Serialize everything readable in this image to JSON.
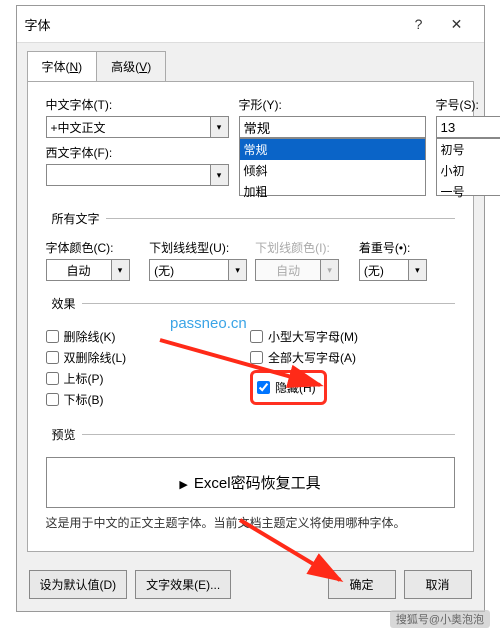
{
  "dialog_title": "字体",
  "tabs": {
    "font": "字体(N)",
    "adv": "高级(V)"
  },
  "labels": {
    "cn_font": "中文字体(T):",
    "west_font": "西文字体(F):",
    "style": "字形(Y):",
    "size": "字号(S):",
    "all_text": "所有文字",
    "font_color": "字体颜色(C):",
    "underline_style": "下划线线型(U):",
    "underline_color": "下划线颜色(I):",
    "emphasis": "着重号(•):",
    "effects": "效果",
    "preview": "预览"
  },
  "values": {
    "cn_font": "+中文正文",
    "west_font": "",
    "style": "常规",
    "size": "13",
    "font_color": "自动",
    "underline_style": "(无)",
    "underline_color": "自动",
    "emphasis": "(无)"
  },
  "style_list": [
    "常规",
    "倾斜",
    "加粗"
  ],
  "size_list": [
    "初号",
    "小初",
    "一号"
  ],
  "effects_left": {
    "strike": "删除线(K)",
    "dstrike": "双删除线(L)",
    "super": "上标(P)",
    "sub": "下标(B)"
  },
  "effects_right": {
    "smallcaps": "小型大写字母(M)",
    "allcaps": "全部大写字母(A)",
    "hidden": "隐藏(H)"
  },
  "preview_text": "Excel密码恢复工具",
  "description": "这是用于中文的正文主题字体。当前文档主题定义将使用哪种字体。",
  "buttons": {
    "default": "设为默认值(D)",
    "text_effects": "文字效果(E)...",
    "ok": "确定",
    "cancel": "取消"
  },
  "watermark": "passneo.cn",
  "attribution": "搜狐号@小奥泡泡"
}
